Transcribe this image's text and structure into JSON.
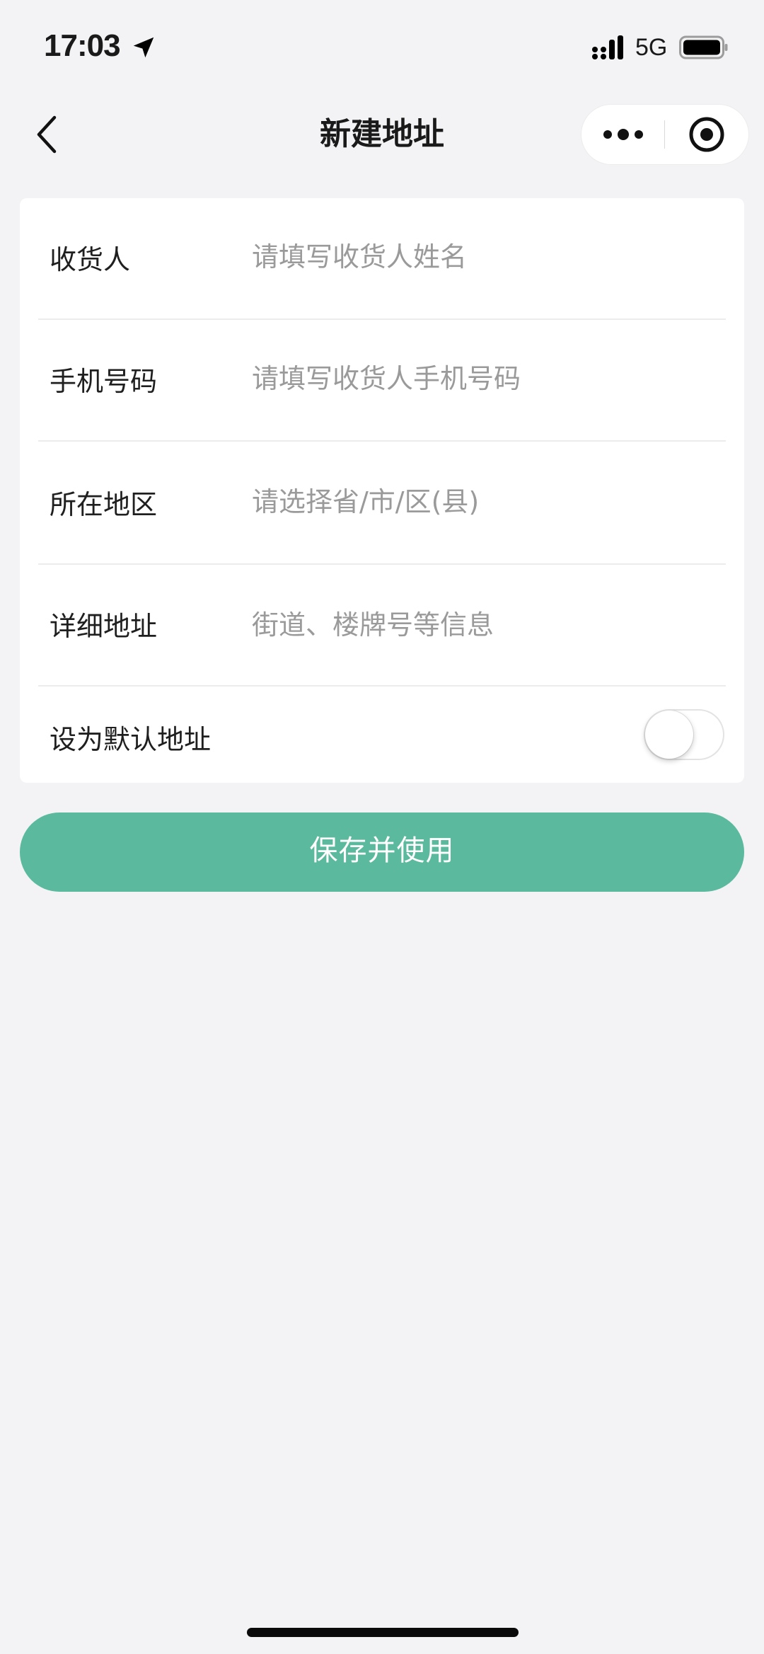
{
  "status_bar": {
    "time": "17:03",
    "network": "5G",
    "icons": [
      "location-arrow-icon",
      "signal-icon",
      "battery-icon"
    ]
  },
  "nav": {
    "title": "新建地址",
    "back_icon": "chevron-left-icon",
    "more_icon": "more-dots-icon",
    "close_icon": "target-close-icon"
  },
  "form": {
    "rows": [
      {
        "label": "收货人",
        "placeholder": "请填写收货人姓名",
        "value": ""
      },
      {
        "label": "手机号码",
        "placeholder": "请填写收货人手机号码",
        "value": ""
      },
      {
        "label": "所在地区",
        "placeholder": "请选择省/市/区(县)",
        "value": ""
      },
      {
        "label": "详细地址",
        "placeholder": "街道、楼牌号等信息",
        "value": ""
      }
    ],
    "default_label": "设为默认地址",
    "default_on": false
  },
  "save_button": {
    "label": "保存并使用"
  },
  "colors": {
    "accent": "#5bba9d",
    "background": "#f3f3f5",
    "placeholder": "#9a9a9a"
  }
}
